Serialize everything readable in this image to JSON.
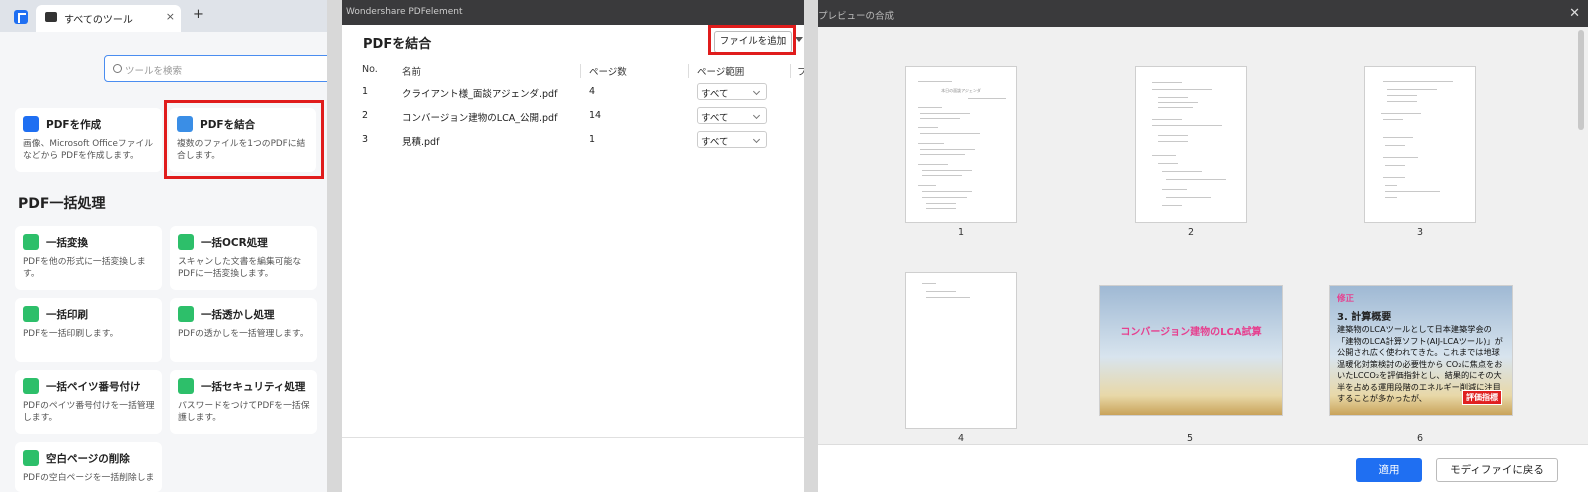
{
  "tools_panel": {
    "tab_title": "すべてのツール",
    "tab_close": "×",
    "new_tab": "+",
    "search_placeholder": "ツールを検索",
    "cards": [
      {
        "title": "PDFを作成",
        "desc": "画像、Microsoft Officeファイルなどから PDFを作成します。",
        "icon": "create-pdf-icon",
        "color": "#1f6ff2"
      },
      {
        "title": "PDFを結合",
        "desc": "複数のファイルを1つのPDFに結合します。",
        "icon": "merge-pdf-icon",
        "color": "#3a8ee6"
      }
    ],
    "section_title": "PDF一括処理",
    "batch_cards": [
      {
        "title": "一括変換",
        "desc": "PDFを他の形式に一括変換します。",
        "icon": "convert-icon",
        "color": "#2dbf6a"
      },
      {
        "title": "一括OCR処理",
        "desc": "スキャンした文書を編集可能なPDFに一括変換します。",
        "icon": "ocr-icon",
        "color": "#2dbf6a"
      },
      {
        "title": "一括印刷",
        "desc": "PDFを一括印刷します。",
        "icon": "print-icon",
        "color": "#2dbf6a"
      },
      {
        "title": "一括透かし処理",
        "desc": "PDFの透かしを一括管理します。",
        "icon": "watermark-icon",
        "color": "#2dbf6a"
      },
      {
        "title": "一括ペイツ番号付け",
        "desc": "PDFのペイツ番号付けを一括管理します。",
        "icon": "page-number-icon",
        "color": "#2dbf6a"
      },
      {
        "title": "一括セキュリティ処理",
        "desc": "パスワードをつけてPDFを一括保護します。",
        "icon": "security-icon",
        "color": "#2dbf6a"
      },
      {
        "title": "空白ページの削除",
        "desc": "PDFの空白ページを一括削除しま",
        "icon": "blank-page-icon",
        "color": "#2dbf6a"
      }
    ]
  },
  "merge_panel": {
    "window_title": "Wondershare PDFelement",
    "title": "PDFを結合",
    "add_file": "ファイルを追加",
    "columns": [
      "No.",
      "名前",
      "ページ数",
      "ページ範囲",
      "フ"
    ],
    "rows": [
      {
        "no": "1",
        "name": "クライアント様_面談アジェンダ.pdf",
        "pages": "4",
        "range": "すべて"
      },
      {
        "no": "2",
        "name": "コンバージョン建物のLCA_公開.pdf",
        "pages": "14",
        "range": "すべて"
      },
      {
        "no": "3",
        "name": "見積.pdf",
        "pages": "1",
        "range": "すべて"
      }
    ]
  },
  "preview_panel": {
    "title": "プレビューの合成",
    "close": "✕",
    "pages": [
      "1",
      "2",
      "3",
      "4",
      "5",
      "6"
    ],
    "page1_heading": "本日の面談アジェンダ",
    "slide5_title": "コンバージョン建物のLCA試算",
    "slide6_tag": "修正",
    "slide6_heading": "3. 計算概要",
    "slide6_body": "建築物のLCAツールとして日本建築学会の「建物のLCA計算ソフト(AIJ-LCAツール)」が公開され広く使われてきた。これまでは地球温暖化対策検討の必要性から CO₂に焦点をおいたLCCO₂を評価指針とし、結果的にその大半を占める運用段階のエネルギー削減に注目することが多かったが、",
    "slide6_badge": "評価指標",
    "apply": "適用",
    "back": "モディファイに戻る"
  }
}
